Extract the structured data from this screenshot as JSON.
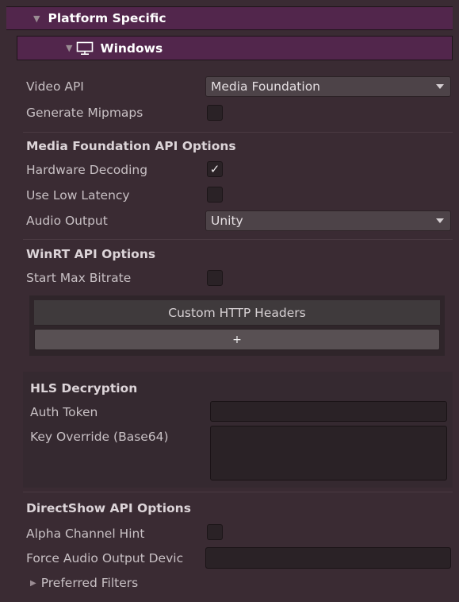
{
  "platform_header": {
    "title": "Platform Specific"
  },
  "windows_header": {
    "title": "Windows"
  },
  "general": {
    "video_api_label": "Video API",
    "video_api_value": "Media Foundation",
    "generate_mipmaps_label": "Generate Mipmaps",
    "generate_mipmaps_checked": false
  },
  "media_foundation": {
    "title": "Media Foundation API Options",
    "hardware_decoding_label": "Hardware Decoding",
    "hardware_decoding_checked": true,
    "hardware_decoding_mark": "✓",
    "low_latency_label": "Use Low Latency",
    "low_latency_checked": false,
    "audio_output_label": "Audio Output",
    "audio_output_value": "Unity"
  },
  "winrt": {
    "title": "WinRT API Options",
    "start_max_bitrate_label": "Start Max Bitrate",
    "start_max_bitrate_checked": false,
    "custom_headers_title": "Custom HTTP Headers",
    "add_button_label": "+"
  },
  "hls": {
    "title": "HLS Decryption",
    "auth_token_label": "Auth Token",
    "auth_token_value": "",
    "key_override_label": "Key Override (Base64)",
    "key_override_value": ""
  },
  "directshow": {
    "title": "DirectShow API Options",
    "alpha_hint_label": "Alpha Channel Hint",
    "alpha_hint_checked": false,
    "force_audio_label": "Force Audio Output Devic",
    "force_audio_value": "",
    "preferred_filters_label": "Preferred Filters"
  }
}
